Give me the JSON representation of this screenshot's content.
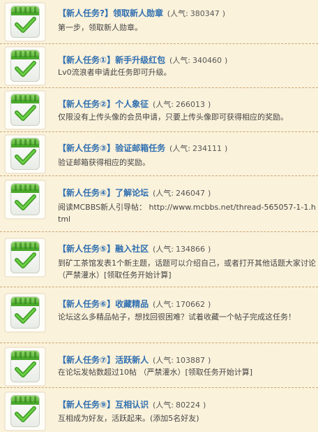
{
  "tasks": [
    {
      "title": "【新人任务?】领取新人勋章",
      "popularity_label": "(人气:",
      "popularity_value": "380347",
      "popularity_close": ")",
      "description": "第一步，领取新人勋章。"
    },
    {
      "title": "【新人任务①】新手升级红包",
      "popularity_label": "(人气:",
      "popularity_value": "340460",
      "popularity_close": ")",
      "description": "Lv0流浪者申请此任务即可升级。"
    },
    {
      "title": "【新人任务②】个人象征",
      "popularity_label": "(人气:",
      "popularity_value": "266013",
      "popularity_close": ")",
      "description": "仅限没有上传头像的会员申请，只要上传头像即可获得相应的奖励。"
    },
    {
      "title": "【新人任务③】验证邮箱任务",
      "popularity_label": "(人气:",
      "popularity_value": "234111",
      "popularity_close": ")",
      "description": "验证邮箱获得相应的奖励。"
    },
    {
      "title": "【新人任务④】了解论坛",
      "popularity_label": "(人气:",
      "popularity_value": "246047",
      "popularity_close": ")",
      "description": "阅读MCBBS新人引导帖： http://www.mcbbs.net/thread-565057-1-1.html"
    },
    {
      "title": "【新人任务⑤】融入社区",
      "popularity_label": "(人气:",
      "popularity_value": "134866",
      "popularity_close": ")",
      "description": "到矿工茶馆发表1个新主题，话题可以介绍自己，或者打开其他话题大家讨论 （严禁灌水）[领取任务开始计算]"
    },
    {
      "title": "【新人任务⑥】收藏精品",
      "popularity_label": "(人气:",
      "popularity_value": "170662",
      "popularity_close": ")",
      "description": "论坛这么多精品帖子，想找回很困难？试着收藏一个帖子完成这任务！"
    },
    {
      "title": "【新人任务⑦】活跃新人",
      "popularity_label": "(人气:",
      "popularity_value": "103887",
      "popularity_close": ")",
      "description": "在论坛发帖数超过10帖 （严禁灌水）[领取任务开始计算]"
    },
    {
      "title": "【新人任务⑨】互相认识",
      "popularity_label": "(人气:",
      "popularity_value": "80224",
      "popularity_close": ")",
      "description": "互相成为好友，活跃起来。(添加5名好友)"
    }
  ]
}
